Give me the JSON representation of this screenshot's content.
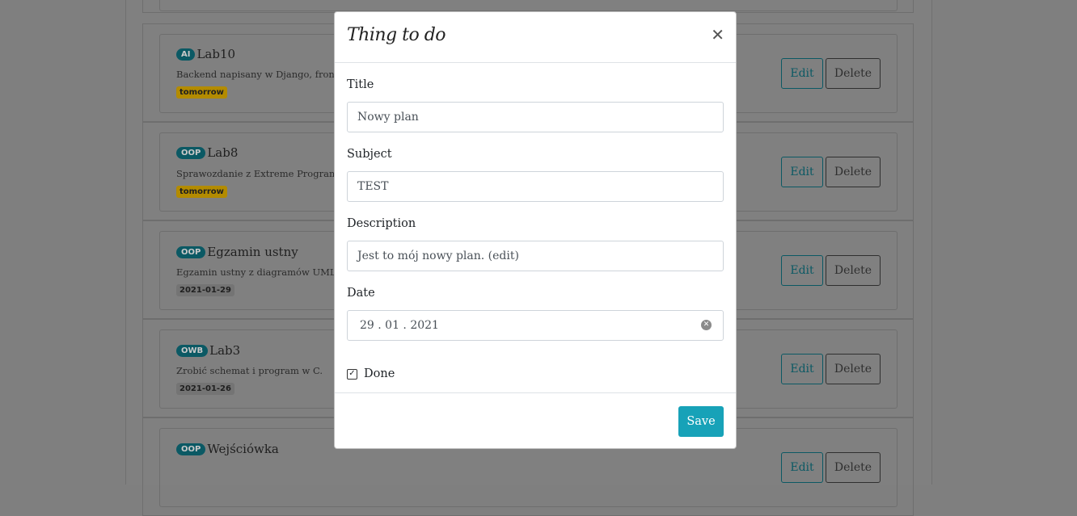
{
  "tasks": [
    {
      "subject": "AI",
      "title": "Lab10",
      "description": "Backend napisany w Django, frontend",
      "date": "tomorrow",
      "date_style": "warn"
    },
    {
      "subject": "OOP",
      "title": "Lab8",
      "description": "Sprawozdanie z Extreme Programming",
      "date": "tomorrow",
      "date_style": "warn"
    },
    {
      "subject": "OOP",
      "title": "Egzamin ustny",
      "description": "Egzamin ustny z diagramów UML, Des",
      "date": "2021-01-29",
      "date_style": "plain"
    },
    {
      "subject": "OWB",
      "title": "Lab3",
      "description": "Zrobić schemat i program w C.",
      "date": "2021-01-26",
      "date_style": "plain"
    },
    {
      "subject": "OOP",
      "title": "Wejściówka",
      "description": "",
      "date": "",
      "date_style": "plain"
    }
  ],
  "buttons": {
    "edit": "Edit",
    "delete": "Delete"
  },
  "modal": {
    "title": "Thing to do",
    "close": "✕",
    "fields": {
      "title": {
        "label": "Title",
        "value": "Nowy plan"
      },
      "subject": {
        "label": "Subject",
        "value": "TEST"
      },
      "description": {
        "label": "Description",
        "value": "Jest to mój nowy plan. (edit)"
      },
      "date": {
        "label": "Date",
        "value": "29 . 01 . 2021"
      }
    },
    "done": {
      "label": "Done",
      "checked": true,
      "check_glyph": "✓"
    },
    "save": "Save"
  }
}
